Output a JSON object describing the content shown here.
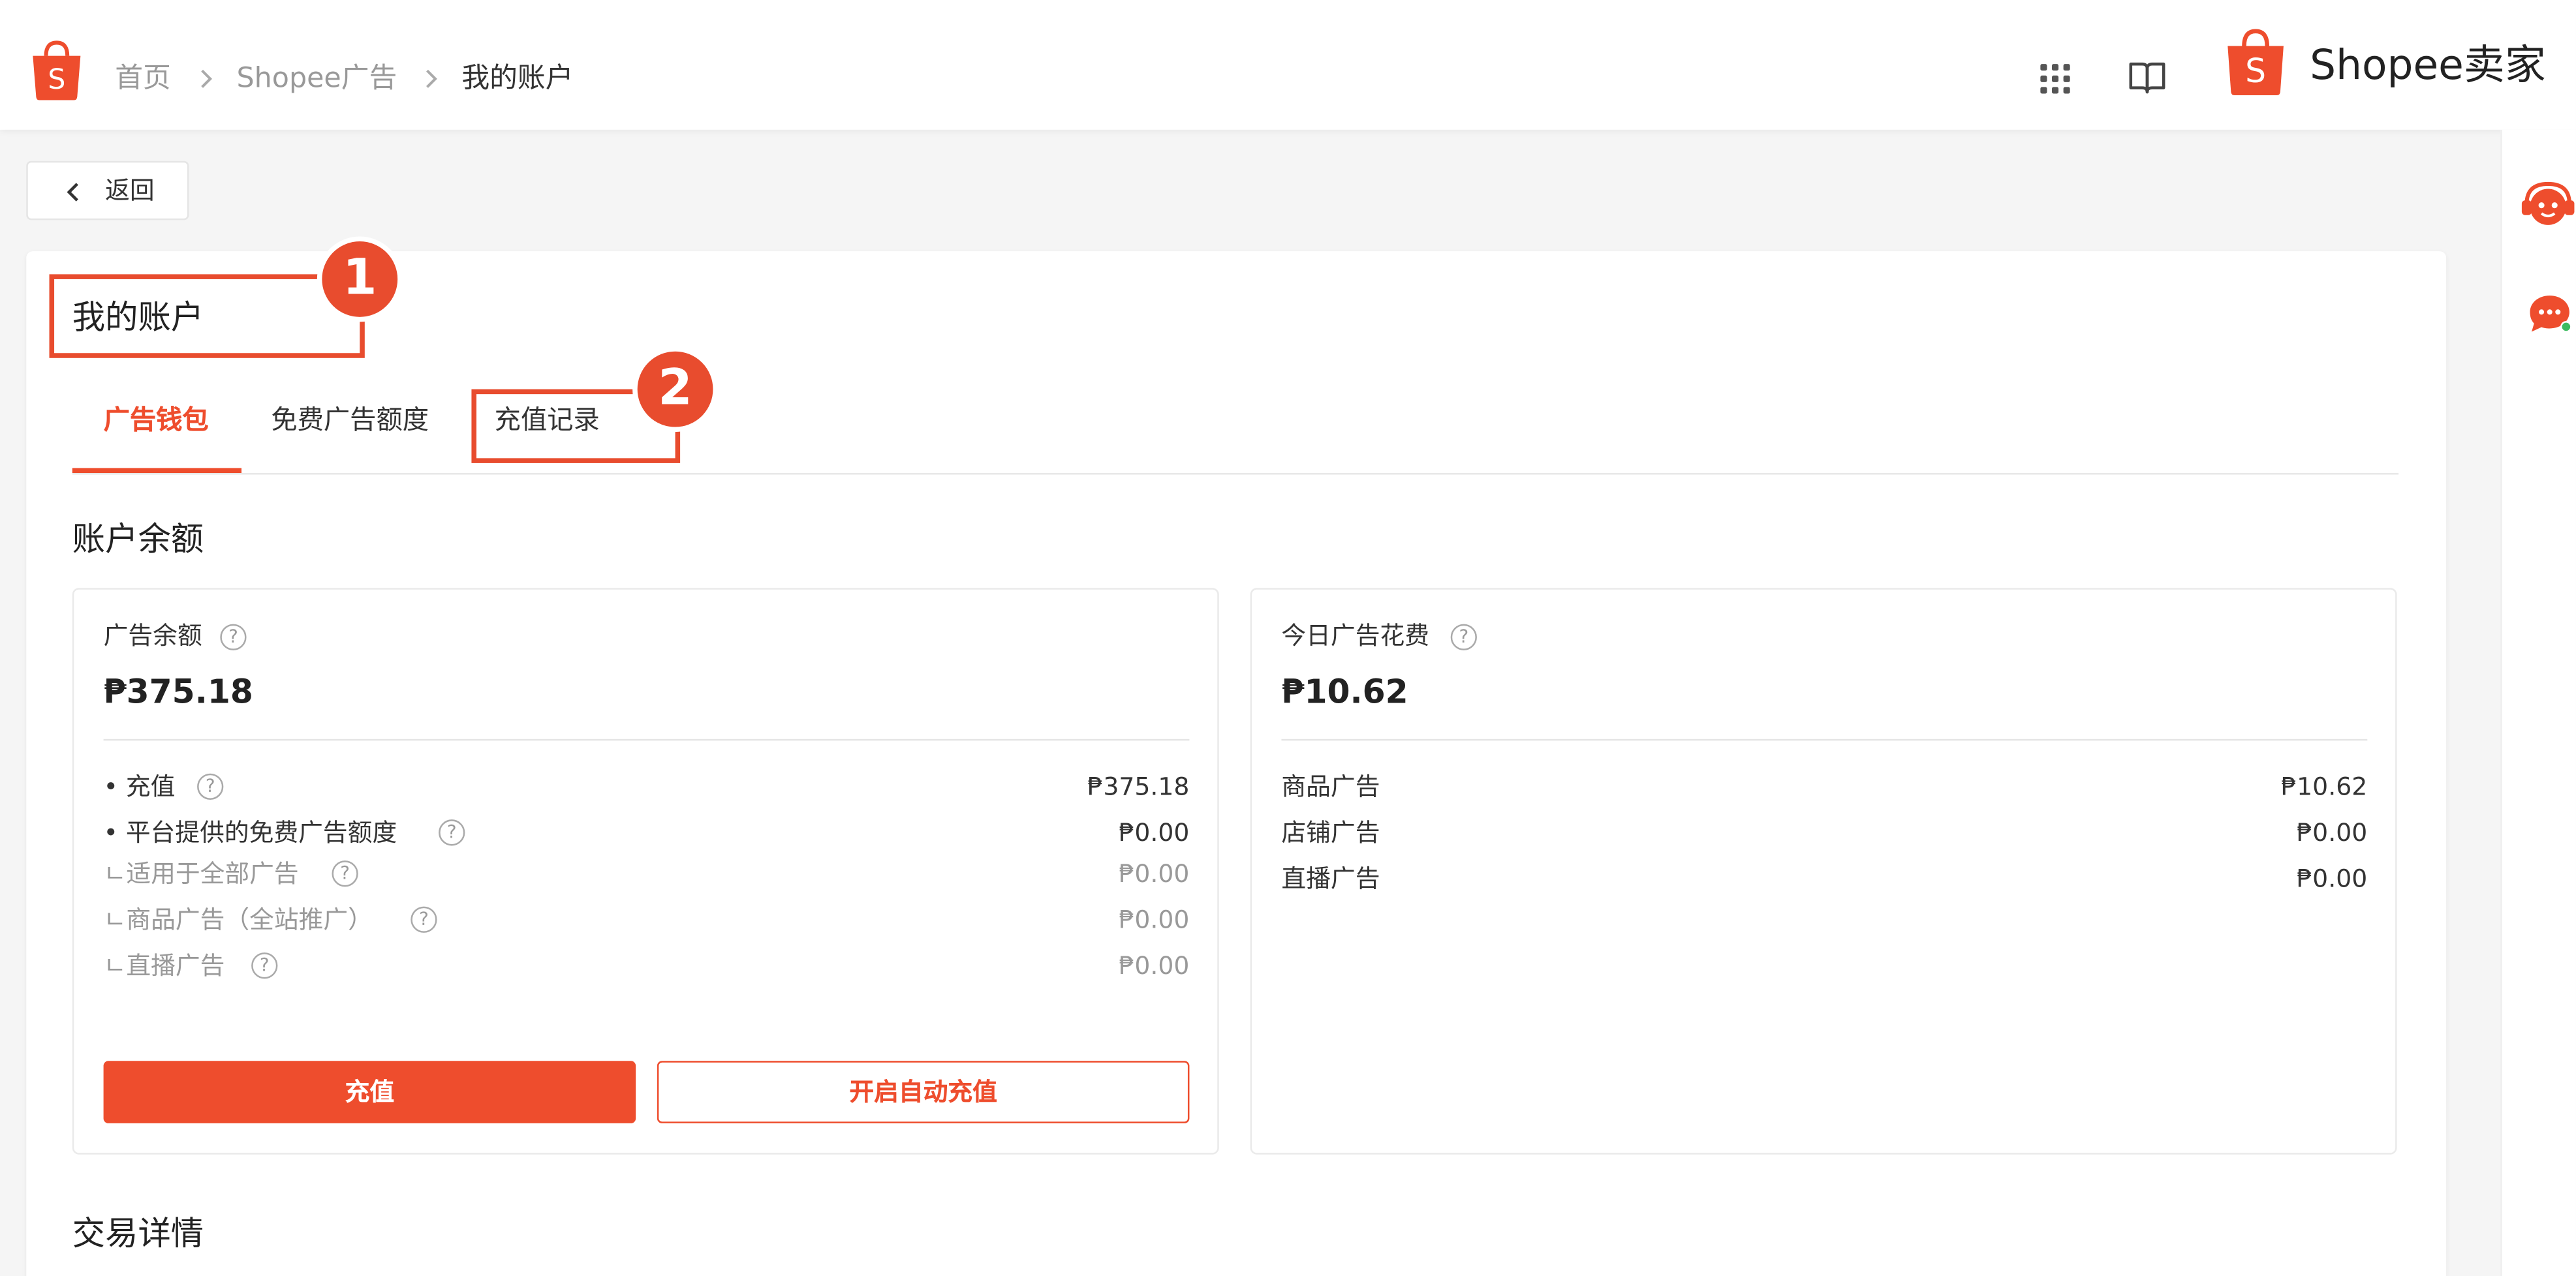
{
  "colors": {
    "accent": "#ee4d2d",
    "annotation": "#e84c2e"
  },
  "breadcrumb": {
    "home": "首页",
    "ads": "Shopee广告",
    "current": "我的账户"
  },
  "header": {
    "brand": "Shopee卖家",
    "icons": [
      "apps-grid-icon",
      "book-icon",
      "shopee-bag-icon"
    ]
  },
  "back_button": {
    "label": "返回"
  },
  "page": {
    "title": "我的账户",
    "annotations": [
      "1",
      "2"
    ],
    "tabs": [
      {
        "label": "广告钱包",
        "active": true
      },
      {
        "label": "免费广告额度",
        "active": false
      },
      {
        "label": "充值记录",
        "active": false
      }
    ]
  },
  "balance_section": {
    "title": "账户余额",
    "ad_balance": {
      "label": "广告余额",
      "amount": "₱375.18",
      "rows": [
        {
          "label": "• 充值",
          "value": "₱375.18"
        },
        {
          "label": "• 平台提供的免费广告额度",
          "value": "₱0.00"
        },
        {
          "label": "ㄴ适用于全部广告",
          "value": "₱0.00"
        },
        {
          "label": "ㄴ商品广告（全站推广）",
          "value": "₱0.00"
        },
        {
          "label": "ㄴ直播广告",
          "value": "₱0.00"
        }
      ],
      "topup_button": "充值",
      "auto_topup_button": "开启自动充值"
    },
    "today_spend": {
      "label": "今日广告花费",
      "amount": "₱10.62",
      "rows": [
        {
          "label": "商品广告",
          "value": "₱10.62"
        },
        {
          "label": "店铺广告",
          "value": "₱0.00"
        },
        {
          "label": "直播广告",
          "value": "₱0.00"
        }
      ]
    }
  },
  "transactions_section": {
    "title": "交易详情"
  },
  "side_rail": {
    "icons": [
      "customer-service-robot-icon",
      "chat-icon"
    ]
  }
}
